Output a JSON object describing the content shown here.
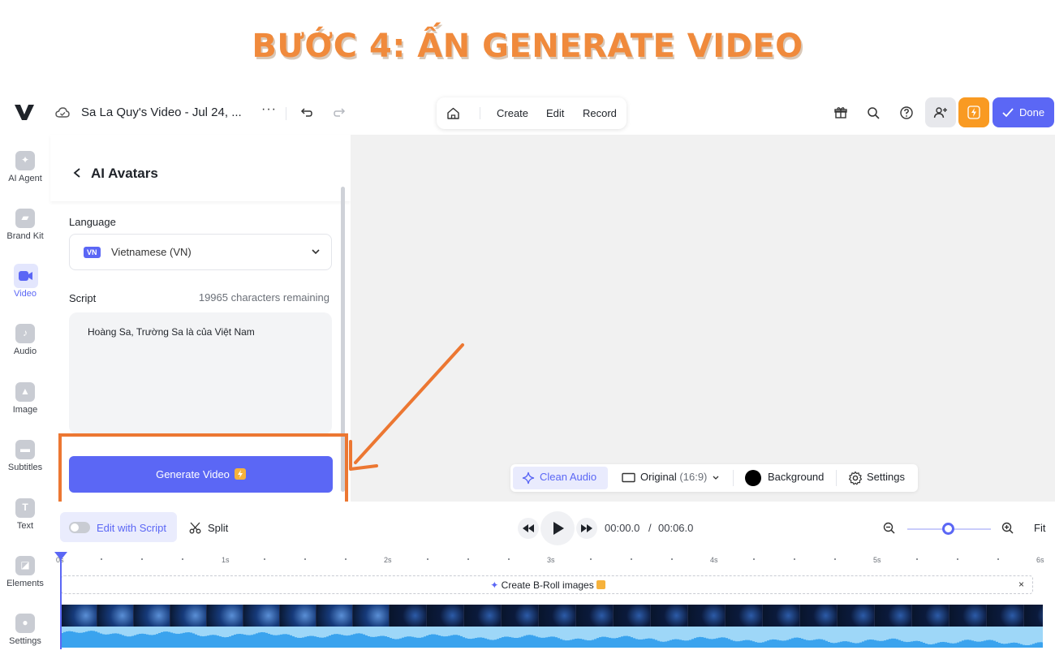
{
  "banner": {
    "title": "BƯỚC 4: ẤN GENERATE VIDEO"
  },
  "topbar": {
    "doc_title": "Sa La Quy's Video - Jul 24, ...",
    "more": "···",
    "nav": [
      "Create",
      "Edit",
      "Record"
    ],
    "done_label": "Done"
  },
  "rail": {
    "items": [
      {
        "label": "AI Agent"
      },
      {
        "label": "Brand Kit"
      },
      {
        "label": "Video"
      },
      {
        "label": "Audio"
      },
      {
        "label": "Image"
      },
      {
        "label": "Subtitles"
      },
      {
        "label": "Text"
      },
      {
        "label": "Elements"
      },
      {
        "label": "Settings"
      }
    ],
    "active": "Video"
  },
  "panel": {
    "title": "AI Avatars",
    "language_label": "Language",
    "language_badge": "VN",
    "language_value": "Vietnamese (VN)",
    "script_label": "Script",
    "chars_remaining": "19965 characters remaining",
    "script_text": "Hoàng Sa, Trường Sa là của Việt Nam",
    "generate_label": "Generate Video"
  },
  "canvas_toolbar": {
    "clean_audio": "Clean Audio",
    "aspect": "Original",
    "aspect_ratio": "(16:9)",
    "background": "Background",
    "settings": "Settings"
  },
  "timeline": {
    "edit_with_script": "Edit with Script",
    "split": "Split",
    "current_time": "00:00.0",
    "time_sep": "/",
    "total_time": "00:06.0",
    "fit": "Fit",
    "zoom_level": 0.5,
    "ticks": [
      "0s",
      "1s",
      "2s",
      "3s",
      "4s",
      "5s",
      "6s"
    ],
    "broll_label": "Create B-Roll images",
    "broll_close": "×"
  },
  "colors": {
    "accent": "#5b67f5",
    "highlight": "#ec7732",
    "banner": "#f08a3c",
    "bolt": "#f99a22"
  }
}
